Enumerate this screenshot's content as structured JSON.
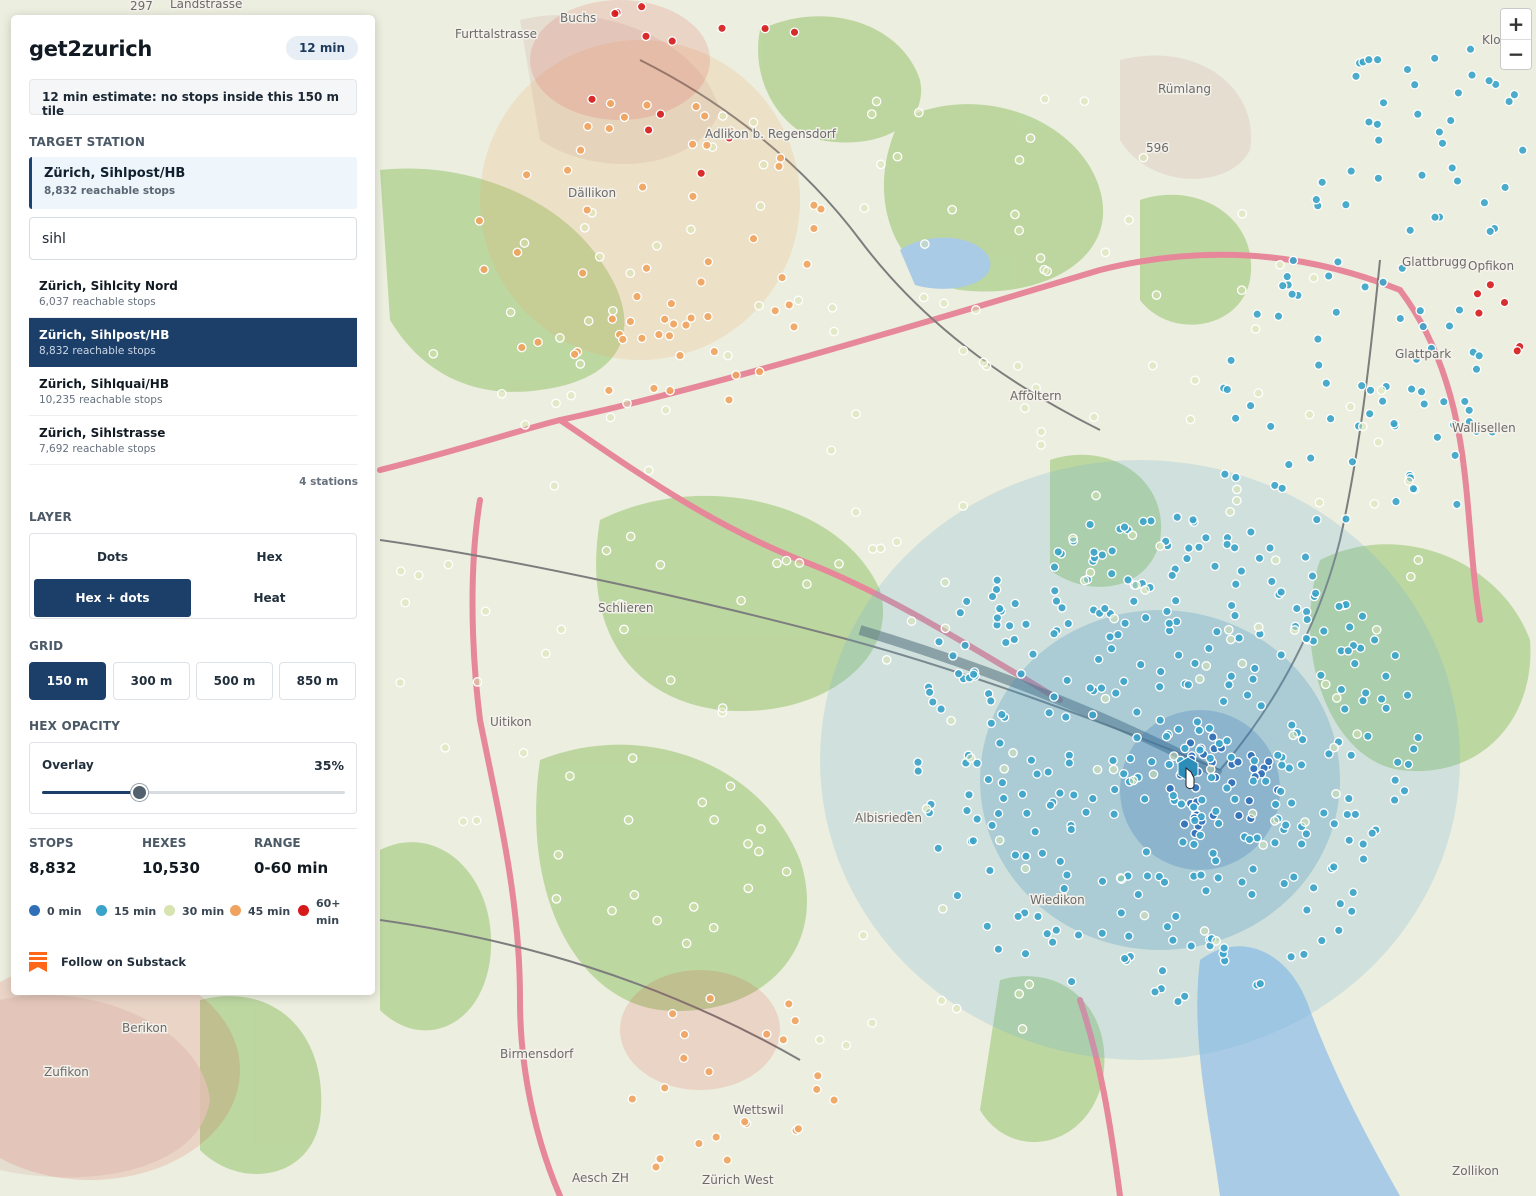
{
  "app": {
    "title": "get2zurich",
    "time_badge": "12 min"
  },
  "estimate": "12 min estimate: no stops inside this 150 m tile",
  "target": {
    "section_label": "TARGET STATION",
    "name": "Zürich, Sihlpost/HB",
    "sub": "8,832 reachable stops"
  },
  "search": {
    "value": "sihl",
    "placeholder": ""
  },
  "results": [
    {
      "name": "Zürich, Sihlcity Nord",
      "sub": "6,037 reachable stops",
      "selected": false
    },
    {
      "name": "Zürich, Sihlpost/HB",
      "sub": "8,832 reachable stops",
      "selected": true
    },
    {
      "name": "Zürich, Sihlquai/HB",
      "sub": "10,235 reachable stops",
      "selected": false
    },
    {
      "name": "Zürich, Sihlstrasse",
      "sub": "7,692 reachable stops",
      "selected": false
    }
  ],
  "results_count": "4 stations",
  "layer": {
    "label": "LAYER",
    "options": [
      "Dots",
      "Hex",
      "Hex + dots",
      "Heat"
    ],
    "active": "Hex + dots"
  },
  "grid": {
    "label": "GRID",
    "options": [
      "150 m",
      "300 m",
      "500 m",
      "850 m"
    ],
    "active": "150 m"
  },
  "hex_opacity": {
    "label": "HEX OPACITY",
    "control_label": "Overlay",
    "value_text": "35%",
    "value": 0.32
  },
  "stats": [
    {
      "label": "STOPS",
      "value": "8,832"
    },
    {
      "label": "HEXES",
      "value": "10,530"
    },
    {
      "label": "RANGE",
      "value": "0-60 min"
    }
  ],
  "legend": [
    {
      "label": "0 min",
      "color": "#2f6fb8"
    },
    {
      "label": "15 min",
      "color": "#3aa3c9"
    },
    {
      "label": "30 min",
      "color": "#d7e4b0"
    },
    {
      "label": "45 min",
      "color": "#f0a35e"
    },
    {
      "label": "60+ min",
      "color": "#d7191c"
    }
  ],
  "substack": {
    "label": "Follow on Substack",
    "icon": "substack-icon",
    "color": "#ff6719"
  },
  "zoom": {
    "in": "+",
    "out": "−"
  },
  "map": {
    "labels": [
      "Buchs",
      "Furttalstrasse",
      "Adlikon b. Regensdorf",
      "Dällikon",
      "Rümlang",
      "596",
      "Zollikon",
      "Zürich West",
      "Aesch ZH",
      "Zufikon",
      "Berikon",
      "Glattbrugg",
      "Opfikon",
      "Glattpark",
      "Wettswil",
      "Schlieren",
      "Birmensdorf",
      "Uitikon",
      "Affoltern",
      "Wiedikon",
      "Albisrieden",
      "Kloten",
      "Wallisellen",
      "Landstrasse",
      "297"
    ]
  }
}
